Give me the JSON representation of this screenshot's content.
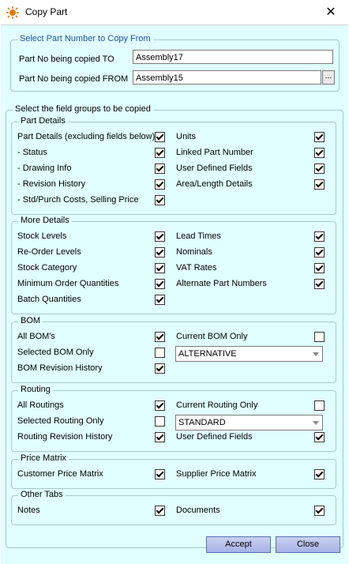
{
  "window": {
    "title": "Copy Part",
    "close_glyph": "✕"
  },
  "copy_from": {
    "legend": "Select Part Number to Copy From",
    "to_label": "Part No being copied TO",
    "to_value": "Assembly17",
    "from_label": "Part No being copied FROM",
    "from_value": "Assembly15",
    "browse_label": "..."
  },
  "field_groups_legend": "Select the field groups to be copied",
  "part_details": {
    "legend": "Part Details",
    "left": [
      {
        "label": "Part Details (excluding fields below)",
        "checked": true
      },
      {
        "label": " - Status",
        "checked": true
      },
      {
        "label": " - Drawing Info",
        "checked": true
      },
      {
        "label": " - Revision History",
        "checked": true
      },
      {
        "label": " - Std/Purch Costs, Selling Price",
        "checked": true
      }
    ],
    "right": [
      {
        "label": "Units",
        "checked": true
      },
      {
        "label": "Linked Part Number",
        "checked": true
      },
      {
        "label": "User Defined Fields",
        "checked": true
      },
      {
        "label": "Area/Length Details",
        "checked": true
      }
    ]
  },
  "more_details": {
    "legend": "More Details",
    "left": [
      {
        "label": "Stock Levels",
        "checked": true
      },
      {
        "label": "Re-Order Levels",
        "checked": true
      },
      {
        "label": "Stock Category",
        "checked": true
      },
      {
        "label": "Minimum Order Quantities",
        "checked": true
      },
      {
        "label": "Batch Quantities",
        "checked": true
      }
    ],
    "right": [
      {
        "label": "Lead Times",
        "checked": true
      },
      {
        "label": "Nominals",
        "checked": true
      },
      {
        "label": "VAT Rates",
        "checked": true
      },
      {
        "label": "Alternate Part Numbers",
        "checked": true
      }
    ]
  },
  "bom": {
    "legend": "BOM",
    "left": [
      {
        "label": "All BOM's",
        "checked": true
      },
      {
        "label": "Selected BOM Only",
        "checked": false
      },
      {
        "label": "BOM Revision History",
        "checked": true
      }
    ],
    "right_check": {
      "label": "Current BOM Only",
      "checked": false
    },
    "combo_value": "ALTERNATIVE"
  },
  "routing": {
    "legend": "Routing",
    "left": [
      {
        "label": "All Routings",
        "checked": true
      },
      {
        "label": "Selected Routing Only",
        "checked": false
      },
      {
        "label": "Routing Revision History",
        "checked": true
      }
    ],
    "right_check": {
      "label": "Current Routing Only",
      "checked": false
    },
    "combo_value": "STANDARD",
    "right_check2": {
      "label": "User Defined Fields",
      "checked": true
    }
  },
  "price_matrix": {
    "legend": "Price Matrix",
    "left": {
      "label": "Customer Price Matrix",
      "checked": true
    },
    "right": {
      "label": "Supplier Price Matrix",
      "checked": true
    }
  },
  "other_tabs": {
    "legend": "Other Tabs",
    "left": {
      "label": "Notes",
      "checked": true
    },
    "right": {
      "label": "Documents",
      "checked": true
    }
  },
  "buttons": {
    "accept": "Accept",
    "close": "Close"
  },
  "colors": {
    "dialog_bg": "#e0fffe",
    "legend_blue": "#1f4fa5"
  }
}
